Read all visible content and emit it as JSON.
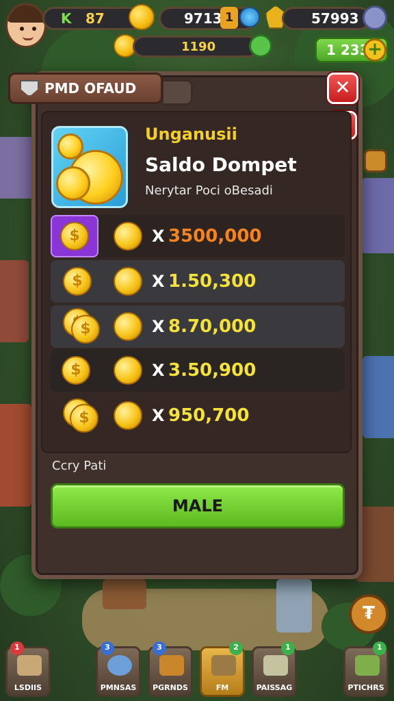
{
  "hud": {
    "coin_label": "87",
    "gem_value": "9713",
    "level_badge": "1",
    "right_value": "57993",
    "sub_value": "1190",
    "green_value": "1 233",
    "level_chevron": "K"
  },
  "panel": {
    "title_tag": "PMD OFAUD",
    "heading_line1": "Unganusii",
    "heading_line2": "Saldo Dompet",
    "heading_line3": "Nerytar Poci oBesadi",
    "rows": [
      {
        "multiplier": "X",
        "amount": "3500,000",
        "color": "#f5841f",
        "selected": true
      },
      {
        "multiplier": "X",
        "amount": "1.50,300",
        "color": "#f4e23a",
        "selected": false
      },
      {
        "multiplier": "X",
        "amount": "8.70,000",
        "color": "#f4e23a",
        "selected": false
      },
      {
        "multiplier": "X",
        "amount": "3.50,900",
        "color": "#f4e23a",
        "selected": false
      },
      {
        "multiplier": "X",
        "amount": "950,700",
        "color": "#f4e23a",
        "selected": false
      }
    ],
    "footer_label": "Ccry Pati",
    "action_button": "MALE"
  },
  "bottom_bar": [
    {
      "label": "LSDIIS",
      "dot": "1",
      "dot_color": "#d83b3b"
    },
    {
      "label": "PMNSAS",
      "dot": "3",
      "dot_color": "#3a6fd1"
    },
    {
      "label": "PGRNDS",
      "dot": "3",
      "dot_color": "#3a6fd1"
    },
    {
      "label": "FM",
      "dot": "2",
      "dot_color": "#3bb04b"
    },
    {
      "label": "PAISSAG",
      "dot": "1",
      "dot_color": "#3bb04b"
    },
    {
      "label": "PTICHRS",
      "dot": "1",
      "dot_color": "#3bb04b"
    }
  ],
  "colors": {
    "panel_bg": "#3f302b",
    "accent_green": "#5cb91f",
    "close_red": "#d82424",
    "coin_gold": "#f7c418"
  },
  "icons": [
    "avatar",
    "coin-icon",
    "gem-icon",
    "lightning-icon",
    "leaf-icon",
    "shield-icon",
    "close-icon",
    "plus-icon",
    "currency-icon"
  ]
}
